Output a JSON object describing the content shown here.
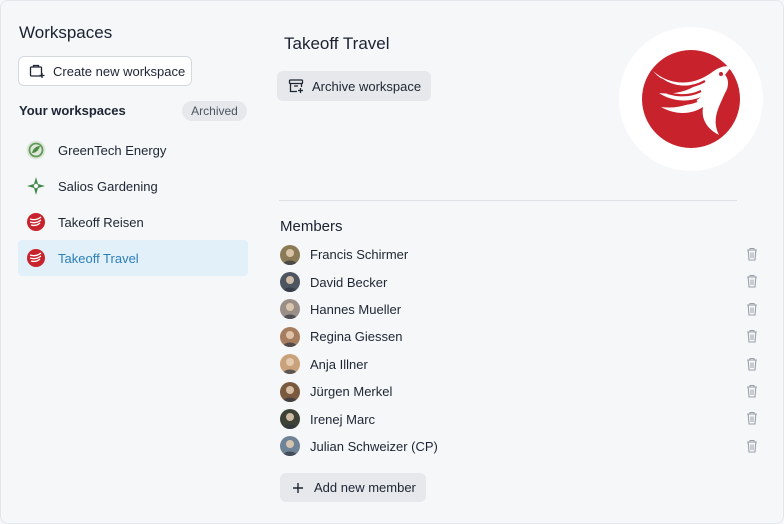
{
  "sidebar": {
    "title": "Workspaces",
    "create_button_label": "Create new workspace",
    "your_workspaces_label": "Your workspaces",
    "archived_label": "Archived",
    "workspaces": [
      {
        "label": "GreenTech Energy",
        "icon": "greentech-logo-icon",
        "active": false
      },
      {
        "label": "Salios Gardening",
        "icon": "salios-logo-icon",
        "active": false
      },
      {
        "label": "Takeoff Reisen",
        "icon": "takeoff-logo-icon",
        "active": false
      },
      {
        "label": "Takeoff Travel",
        "icon": "takeoff-logo-icon",
        "active": true
      }
    ]
  },
  "main": {
    "title": "Takeoff Travel",
    "archive_button_label": "Archive workspace",
    "members_title": "Members",
    "members": [
      {
        "name": "Francis Schirmer",
        "avatar_color": "#8a7a55"
      },
      {
        "name": "David Becker",
        "avatar_color": "#4d5560"
      },
      {
        "name": "Hannes Mueller",
        "avatar_color": "#9a8f86"
      },
      {
        "name": "Regina Giessen",
        "avatar_color": "#a67d5f"
      },
      {
        "name": "Anja Illner",
        "avatar_color": "#c9a27c"
      },
      {
        "name": "Jürgen Merkel",
        "avatar_color": "#7a5a3f"
      },
      {
        "name": "Irenej Marc",
        "avatar_color": "#3d4237"
      },
      {
        "name": "Julian Schweizer (CP)",
        "avatar_color": "#6f8396"
      }
    ],
    "add_member_label": "Add new member"
  },
  "colors": {
    "accent": "#2c7fb8",
    "active_bg": "#e2f0fa",
    "brand_red": "#c8232c"
  }
}
